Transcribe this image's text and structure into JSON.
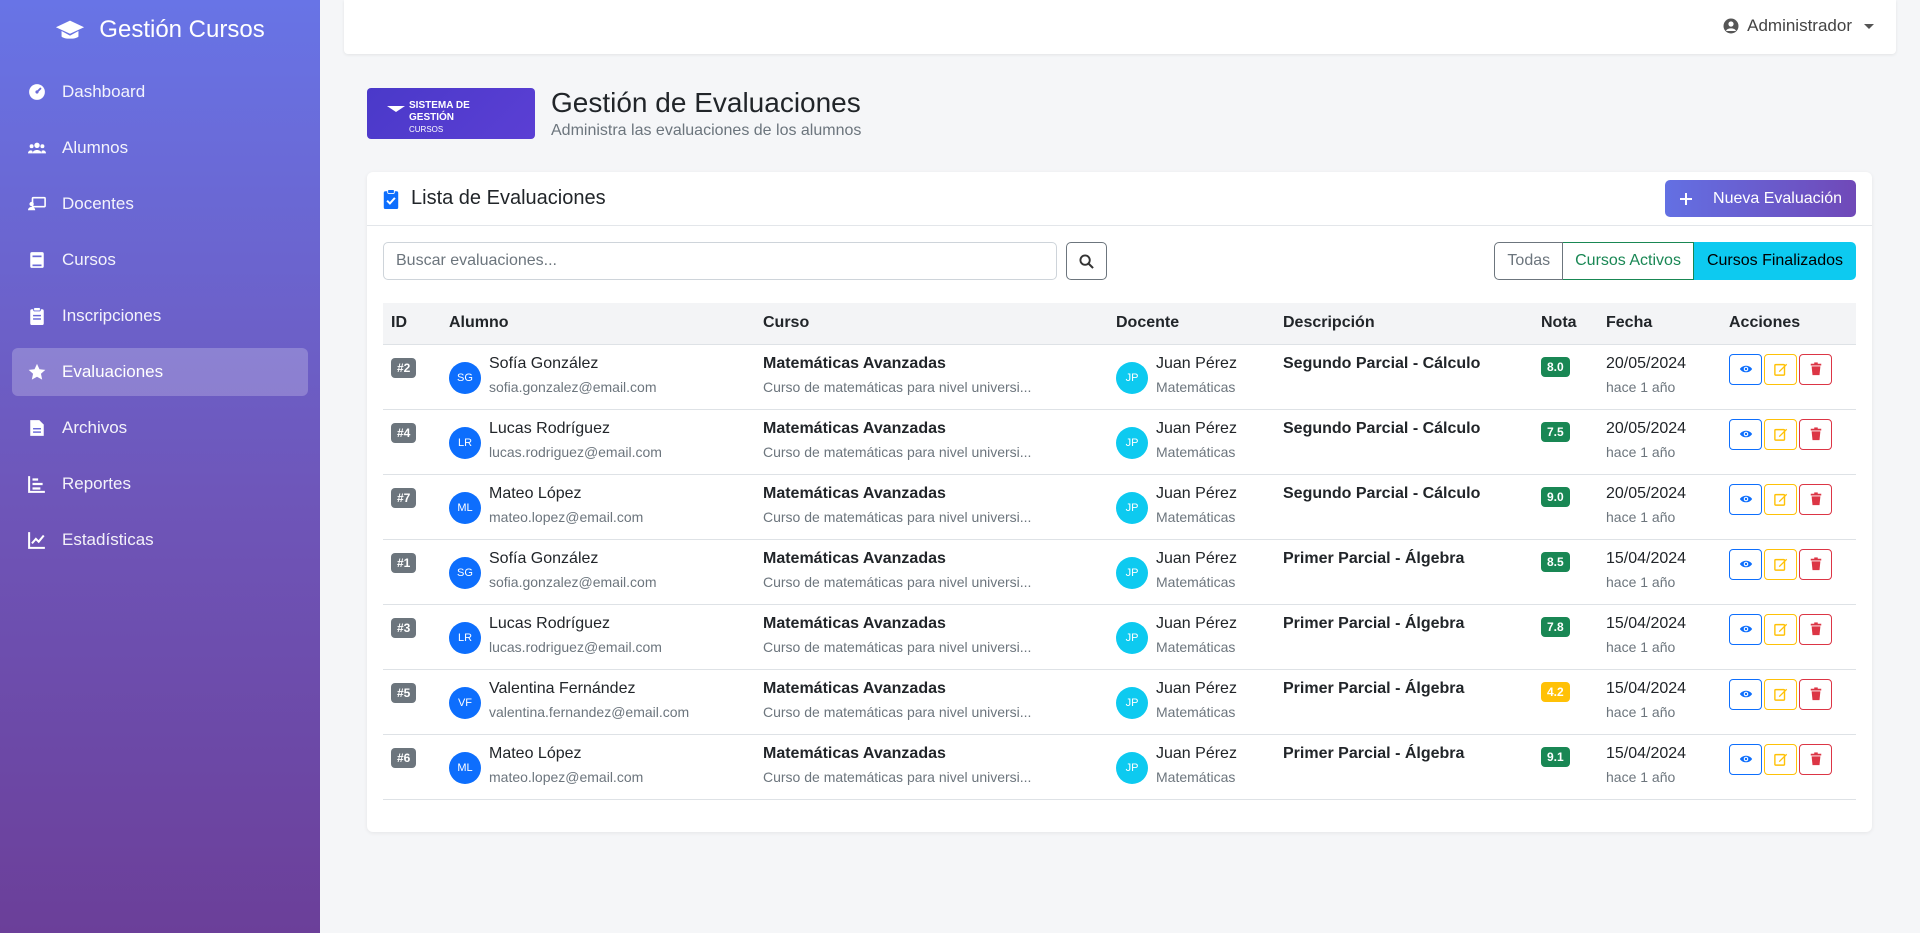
{
  "brand": {
    "title": "Gestión Cursos"
  },
  "sidebar": {
    "items": [
      {
        "label": "Dashboard",
        "icon": "dashboard-icon"
      },
      {
        "label": "Alumnos",
        "icon": "users-icon"
      },
      {
        "label": "Docentes",
        "icon": "teacher-icon"
      },
      {
        "label": "Cursos",
        "icon": "book-icon"
      },
      {
        "label": "Inscripciones",
        "icon": "clipboard-icon"
      },
      {
        "label": "Evaluaciones",
        "icon": "star-icon",
        "active": true
      },
      {
        "label": "Archivos",
        "icon": "file-icon"
      },
      {
        "label": "Reportes",
        "icon": "list-chart-icon"
      },
      {
        "label": "Estadísticas",
        "icon": "line-chart-icon"
      }
    ]
  },
  "topbar": {
    "user": "Administrador"
  },
  "header": {
    "logo_line1": "SISTEMA DE GESTIÓN",
    "logo_line2": "CURSOS",
    "title": "Gestión de Evaluaciones",
    "subtitle": "Administra las evaluaciones de los alumnos"
  },
  "card": {
    "title": "Lista de Evaluaciones",
    "new_button": "Nueva Evaluación",
    "search_placeholder": "Buscar evaluaciones...",
    "filters": {
      "all": "Todas",
      "active": "Cursos Activos",
      "finished": "Cursos Finalizados"
    }
  },
  "table": {
    "columns": [
      "ID",
      "Alumno",
      "Curso",
      "Docente",
      "Descripción",
      "Nota",
      "Fecha",
      "Acciones"
    ],
    "rows": [
      {
        "id": "#2",
        "initials": "SG",
        "name": "Sofía González",
        "email": "sofia.gonzalez@email.com",
        "course": "Matemáticas Avanzadas",
        "course_desc": "Curso de matemáticas para nivel universi...",
        "teacher_initials": "JP",
        "teacher": "Juan Pérez",
        "teacher_area": "Matemáticas",
        "description": "Segundo Parcial - Cálculo",
        "grade": "8.0",
        "grade_color": "#198754",
        "date": "20/05/2024",
        "ago": "hace 1 año"
      },
      {
        "id": "#4",
        "initials": "LR",
        "name": "Lucas Rodríguez",
        "email": "lucas.rodriguez@email.com",
        "course": "Matemáticas Avanzadas",
        "course_desc": "Curso de matemáticas para nivel universi...",
        "teacher_initials": "JP",
        "teacher": "Juan Pérez",
        "teacher_area": "Matemáticas",
        "description": "Segundo Parcial - Cálculo",
        "grade": "7.5",
        "grade_color": "#198754",
        "date": "20/05/2024",
        "ago": "hace 1 año"
      },
      {
        "id": "#7",
        "initials": "ML",
        "name": "Mateo López",
        "email": "mateo.lopez@email.com",
        "course": "Matemáticas Avanzadas",
        "course_desc": "Curso de matemáticas para nivel universi...",
        "teacher_initials": "JP",
        "teacher": "Juan Pérez",
        "teacher_area": "Matemáticas",
        "description": "Segundo Parcial - Cálculo",
        "grade": "9.0",
        "grade_color": "#198754",
        "date": "20/05/2024",
        "ago": "hace 1 año"
      },
      {
        "id": "#1",
        "initials": "SG",
        "name": "Sofía González",
        "email": "sofia.gonzalez@email.com",
        "course": "Matemáticas Avanzadas",
        "course_desc": "Curso de matemáticas para nivel universi...",
        "teacher_initials": "JP",
        "teacher": "Juan Pérez",
        "teacher_area": "Matemáticas",
        "description": "Primer Parcial - Álgebra",
        "grade": "8.5",
        "grade_color": "#198754",
        "date": "15/04/2024",
        "ago": "hace 1 año"
      },
      {
        "id": "#3",
        "initials": "LR",
        "name": "Lucas Rodríguez",
        "email": "lucas.rodriguez@email.com",
        "course": "Matemáticas Avanzadas",
        "course_desc": "Curso de matemáticas para nivel universi...",
        "teacher_initials": "JP",
        "teacher": "Juan Pérez",
        "teacher_area": "Matemáticas",
        "description": "Primer Parcial - Álgebra",
        "grade": "7.8",
        "grade_color": "#198754",
        "date": "15/04/2024",
        "ago": "hace 1 año"
      },
      {
        "id": "#5",
        "initials": "VF",
        "name": "Valentina Fernández",
        "email": "valentina.fernandez@email.com",
        "course": "Matemáticas Avanzadas",
        "course_desc": "Curso de matemáticas para nivel universi...",
        "teacher_initials": "JP",
        "teacher": "Juan Pérez",
        "teacher_area": "Matemáticas",
        "description": "Primer Parcial - Álgebra",
        "grade": "4.2",
        "grade_color": "#ffc107",
        "date": "15/04/2024",
        "ago": "hace 1 año"
      },
      {
        "id": "#6",
        "initials": "ML",
        "name": "Mateo López",
        "email": "mateo.lopez@email.com",
        "course": "Matemáticas Avanzadas",
        "course_desc": "Curso de matemáticas para nivel universi...",
        "teacher_initials": "JP",
        "teacher": "Juan Pérez",
        "teacher_area": "Matemáticas",
        "description": "Primer Parcial - Álgebra",
        "grade": "9.1",
        "grade_color": "#198754",
        "date": "15/04/2024",
        "ago": "hace 1 año"
      }
    ]
  }
}
